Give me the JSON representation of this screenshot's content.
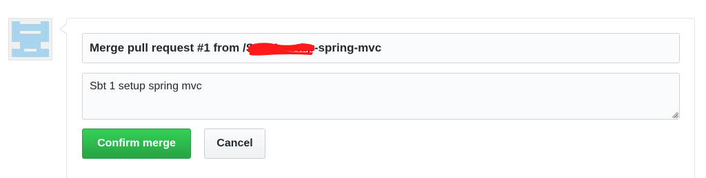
{
  "merge_form": {
    "title_value": "Merge pull request #1 from                          /SBT-1-setup-spring-mvc",
    "message_value": "Sbt 1 setup spring mvc",
    "confirm_label": "Confirm merge",
    "cancel_label": "Cancel"
  },
  "colors": {
    "confirm_bg": "#28a745",
    "border": "#e1e4e8",
    "redaction": "#ff0000",
    "avatar_blocks": "#a8d4ee"
  },
  "icons": {
    "avatar": "identicon-avatar",
    "resize": "resize-handle-icon"
  }
}
